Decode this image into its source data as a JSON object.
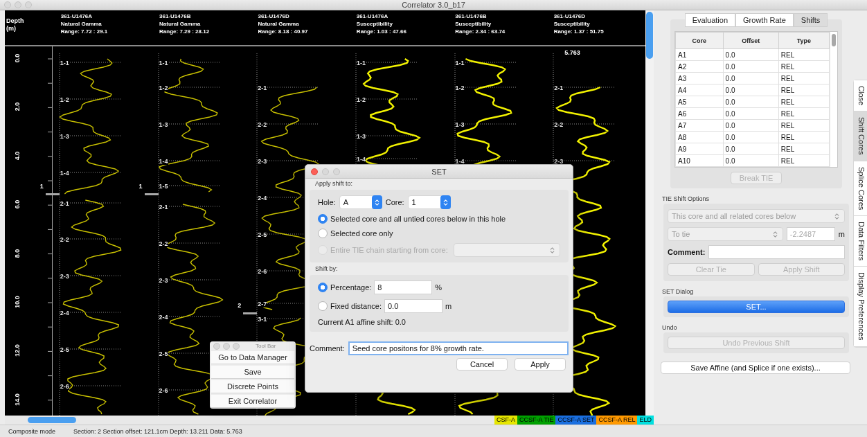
{
  "window": {
    "title": "Correlator 3.0_b17"
  },
  "depth_axis": {
    "label": "Depth (m)",
    "ticks": [
      "0.0",
      "2.0",
      "4.0",
      "6.0",
      "8.0",
      "10.0",
      "12.0",
      "14.0"
    ]
  },
  "tracks": [
    {
      "hole": "361-U1476A",
      "data_type": "Natural Gamma",
      "range": "Range: 7.72 : 29.1",
      "core_labels": [
        "1-1",
        "1-2",
        "1-3",
        "1-4",
        "2-1",
        "2-2",
        "2-3",
        "2-4",
        "2-5",
        "2-6"
      ],
      "tie_marker": "1"
    },
    {
      "hole": "361-U1476B",
      "data_type": "Natural Gamma",
      "range": "Range: 7.29 : 28.12",
      "core_labels": [
        "1-1",
        "1-2",
        "1-3",
        "1-4",
        "1-5",
        "2-1",
        "2-2",
        "2-3",
        "2-4",
        "2-5",
        "2-6"
      ],
      "tie_marker": "1"
    },
    {
      "hole": "361-U1476D",
      "data_type": "Natural Gamma",
      "range": "Range: 8.18 : 40.97",
      "core_labels": [
        "2-1",
        "2-2",
        "2-3",
        "2-4",
        "2-5",
        "2-6",
        "2-7",
        "3-1"
      ],
      "tie_marker": "2"
    },
    {
      "hole": "361-U1476A",
      "data_type": "Susceptibility",
      "range": "Range: 1.03 : 47.66",
      "core_labels": [
        "1-1",
        "1-2",
        "1-3",
        "1-4"
      ]
    },
    {
      "hole": "361-U1476B",
      "data_type": "Susceptibility",
      "range": "Range: 2.34 : 63.74",
      "core_labels": [
        "1-1",
        "1-2",
        "1-3",
        "1-4"
      ]
    },
    {
      "hole": "361-U1476D",
      "data_type": "Susceptibility",
      "range": "Range: 1.37 : 51.75",
      "core_labels": [
        "2-1",
        "2-2",
        "2-3"
      ],
      "readout": "5.763"
    }
  ],
  "legend": [
    {
      "label": "CSF-A",
      "color": "#e6e600"
    },
    {
      "label": "CCSF-A TIE",
      "color": "#00a000"
    },
    {
      "label": "CCSF-A SET",
      "color": "#1a6fe0"
    },
    {
      "label": "CCSF-A REL",
      "color": "#ff9900"
    },
    {
      "label": "ELD",
      "color": "#00e0e0"
    }
  ],
  "status_bar": {
    "mode": "Composite mode",
    "info": "Section: 2 Section offset: 121.1cm Depth: 13.211 Data: 5.763"
  },
  "side_panel": {
    "tabs": [
      {
        "label": "Evaluation",
        "selected": false
      },
      {
        "label": "Growth Rate",
        "selected": false
      },
      {
        "label": "Shifts",
        "selected": true
      }
    ],
    "table": {
      "columns": [
        "Core",
        "Offset",
        "Type"
      ],
      "rows": [
        [
          "A1",
          "0.0",
          "REL"
        ],
        [
          "A2",
          "0.0",
          "REL"
        ],
        [
          "A3",
          "0.0",
          "REL"
        ],
        [
          "A4",
          "0.0",
          "REL"
        ],
        [
          "A5",
          "0.0",
          "REL"
        ],
        [
          "A6",
          "0.0",
          "REL"
        ],
        [
          "A7",
          "0.0",
          "REL"
        ],
        [
          "A8",
          "0.0",
          "REL"
        ],
        [
          "A9",
          "0.0",
          "REL"
        ],
        [
          "A10",
          "0.0",
          "REL"
        ]
      ]
    },
    "break_tie": {
      "label": "Break TIE",
      "disabled": true
    },
    "tie_options": {
      "title": "TIE Shift Options",
      "disabled": true,
      "mode": "This core and all related cores below",
      "target": "To tie",
      "value": "-2.2487",
      "unit": "m",
      "comment_label": "Comment:",
      "buttons": [
        {
          "label": "Clear Tie",
          "disabled": true
        },
        {
          "label": "Apply Shift",
          "disabled": true
        }
      ]
    },
    "set_section": {
      "title": "SET Dialog",
      "button": "SET..."
    },
    "undo_section": {
      "title": "Undo",
      "button": {
        "label": "Undo Previous Shift",
        "disabled": true
      }
    },
    "save_button": "Save Affine (and Splice if one exists)...",
    "vertical_tabs": [
      {
        "label": "Close",
        "selected": false
      },
      {
        "label": "Shift Cores",
        "selected": true
      },
      {
        "label": "Splice Cores",
        "selected": false
      },
      {
        "label": "Data Filters",
        "selected": false
      },
      {
        "label": "Display Preferences",
        "selected": false
      }
    ]
  },
  "tool_bar": {
    "title": "Tool Bar",
    "buttons": [
      "Go to Data Manager",
      "Save",
      "Discrete Points",
      "Exit Correlator"
    ]
  },
  "set_dialog": {
    "title": "SET",
    "apply_label": "Apply shift to:",
    "hole_label": "Hole:",
    "hole": "A",
    "core_label": "Core:",
    "core": "1",
    "apply_options": [
      {
        "label": "Selected core and all untied cores below in this hole",
        "kind": "plain",
        "selected": true,
        "disabled": false
      },
      {
        "label": "Selected core only",
        "kind": "plain",
        "selected": false,
        "disabled": false
      },
      {
        "label": "Entire TIE chain starting from core:",
        "kind": "select",
        "selected": false,
        "disabled": true
      }
    ],
    "shift_label": "Shift by:",
    "shift_options": [
      {
        "label": "Percentage:",
        "value": "8",
        "unit": "%",
        "selected": true
      },
      {
        "label": "Fixed distance:",
        "value": "0.0",
        "unit": "m",
        "selected": false
      }
    ],
    "current_shift": "Current A1 affine shift: 0.0",
    "comment_label": "Comment:",
    "comment": "Seed core positons for 8% growth rate.",
    "buttons": [
      "Cancel",
      "Apply"
    ]
  }
}
